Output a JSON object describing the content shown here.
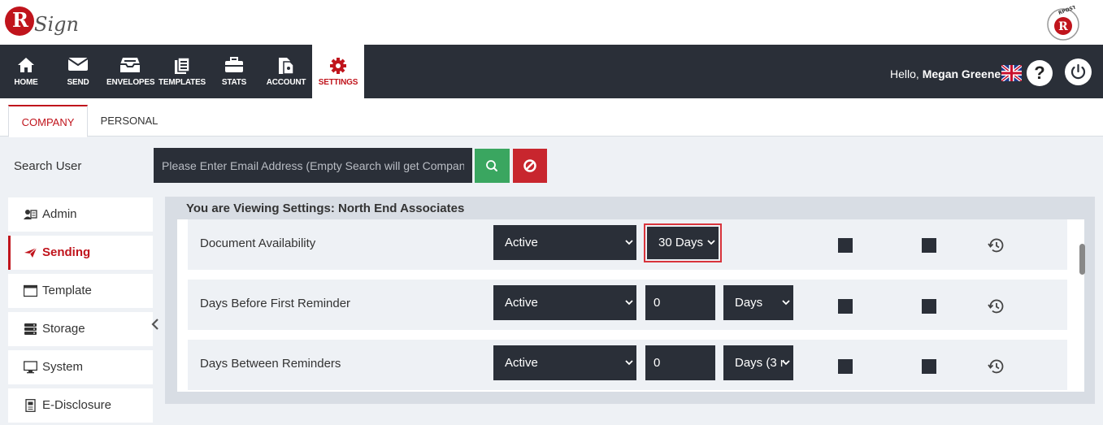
{
  "app": {
    "logo_text": "Sign",
    "logo_letter": "R",
    "brand_badge": "RPOST"
  },
  "nav": {
    "items": [
      {
        "label": "HOME",
        "icon": "home-icon"
      },
      {
        "label": "SEND",
        "icon": "mail-icon"
      },
      {
        "label": "ENVELOPES",
        "icon": "inbox-icon"
      },
      {
        "label": "TEMPLATES",
        "icon": "templates-icon"
      },
      {
        "label": "STATS",
        "icon": "briefcase-icon"
      },
      {
        "label": "ACCOUNT",
        "icon": "account-icon"
      },
      {
        "label": "SETTINGS",
        "icon": "gear-icon",
        "active": true
      }
    ],
    "greeting_prefix": "Hello,",
    "user_name": "Megan Greene",
    "help_label": "?"
  },
  "tabs": [
    {
      "label": "COMPANY",
      "active": true
    },
    {
      "label": "PERSONAL",
      "active": false
    }
  ],
  "search": {
    "label": "Search User",
    "placeholder": "Please Enter Email Address (Empty Search will get Company Settings)"
  },
  "sidebar": {
    "items": [
      {
        "label": "Admin",
        "icon": "admin-icon"
      },
      {
        "label": "Sending",
        "icon": "send-icon",
        "active": true
      },
      {
        "label": "Template",
        "icon": "template-icon"
      },
      {
        "label": "Storage",
        "icon": "storage-icon"
      },
      {
        "label": "System",
        "icon": "monitor-icon"
      },
      {
        "label": "E-Disclosure",
        "icon": "document-icon"
      }
    ]
  },
  "settings": {
    "heading": "You are Viewing Settings: North End Associates",
    "rows": [
      {
        "label": "Document Availability",
        "status": "Active",
        "value": "30 Days",
        "unit": ""
      },
      {
        "label": "Days Before First Reminder",
        "status": "Active",
        "value": "0",
        "unit": "Days"
      },
      {
        "label": "Days Between Reminders",
        "status": "Active",
        "value": "0",
        "unit": "Days (3 r"
      }
    ]
  },
  "colors": {
    "nav_bg": "#2a2f38",
    "brand_red": "#c0141c",
    "search_green": "#3aa660",
    "clear_red": "#c8262e",
    "page_bg": "#eef1f5"
  }
}
